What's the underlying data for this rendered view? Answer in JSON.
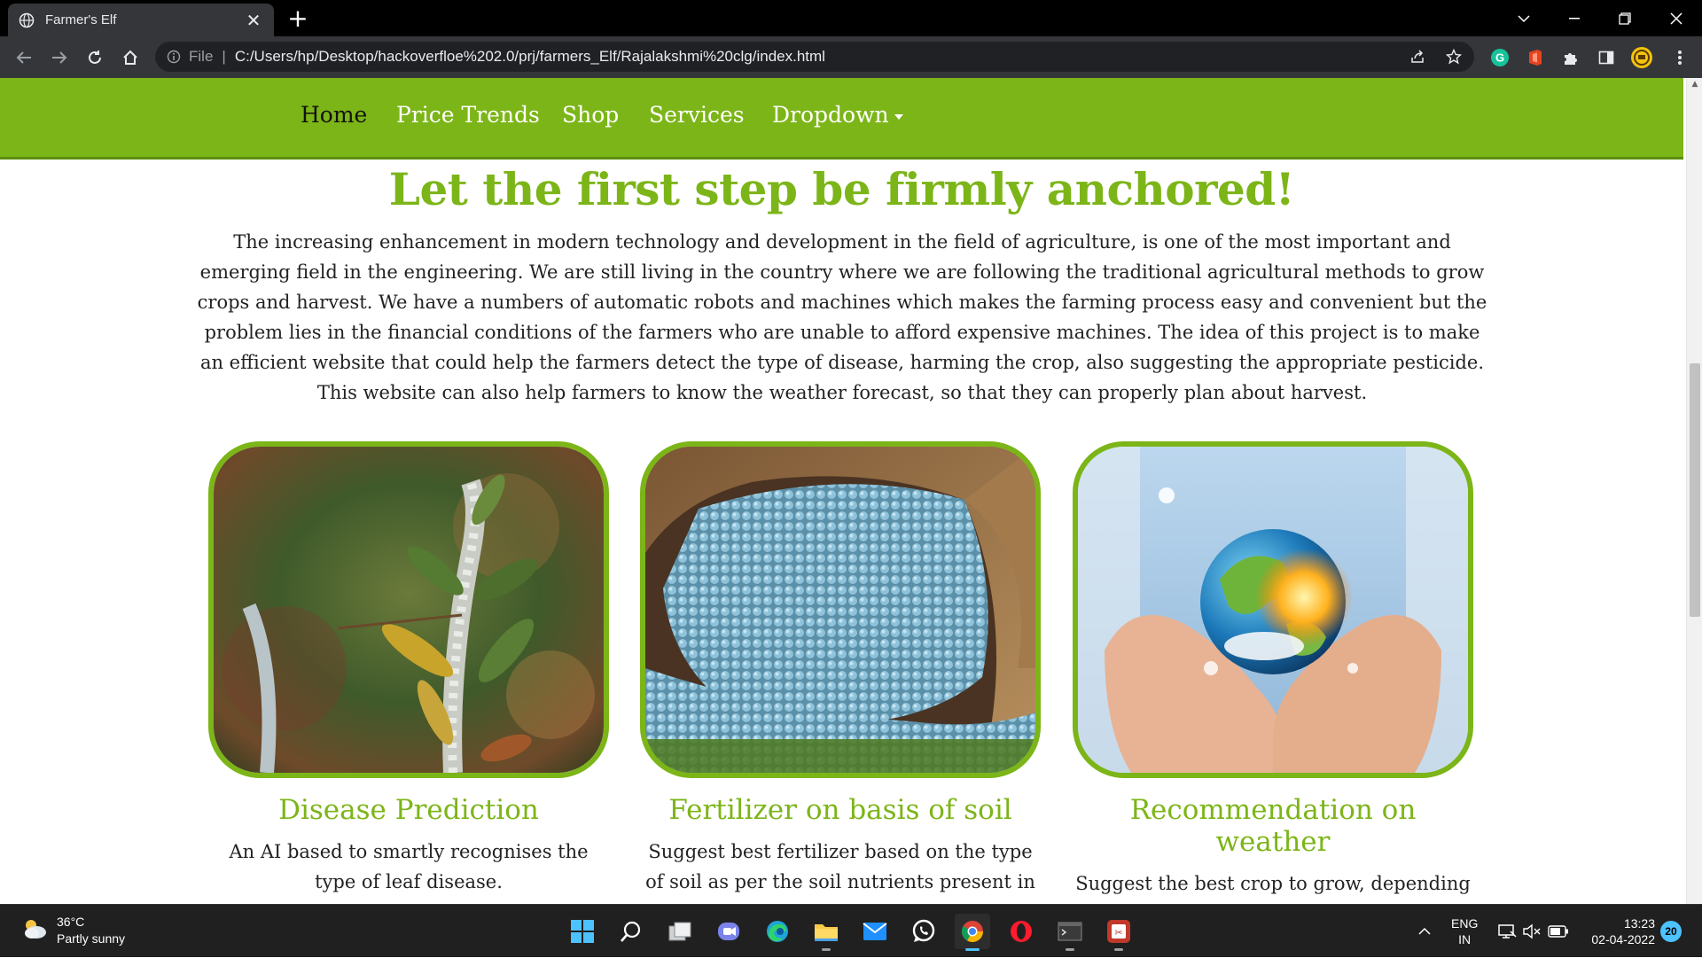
{
  "browser": {
    "tab_title": "Farmer's Elf",
    "url_scheme": "File",
    "url": "C:/Users/hp/Desktop/hackoverfloe%202.0/prj/farmers_Elf/Rajalakshmi%20clg/index.html"
  },
  "site": {
    "nav": [
      {
        "label": "Home",
        "active": true
      },
      {
        "label": "Price Trends"
      },
      {
        "label": "Shop"
      },
      {
        "label": "Services"
      },
      {
        "label": "Dropdown"
      }
    ],
    "hero_title": "Let the first step be firmly anchored!",
    "intro": "The increasing enhancement in modern technology and development in the field of agriculture, is one of the most important and emerging field in the engineering. We are still living in the country where we are following the traditional agricultural methods to grow crops and harvest. We have a numbers of automatic robots and machines which makes the farming process easy and convenient but the problem lies in the financial conditions of the farmers who are unable to afford expensive machines. The idea of this project is to make an efficient website that could help the farmers detect the type of disease, harming the crop, also suggesting the appropriate pesticide. This website can also help farmers to know the weather forecast, so that they can properly plan about harvest.",
    "cards": [
      {
        "title": "Disease Prediction",
        "text": "An AI based to smartly recognises the type of leaf disease."
      },
      {
        "title": "Fertilizer on basis of soil",
        "text": "Suggest best fertilizer based on the type of soil as per the soil nutrients present in it."
      },
      {
        "title": "Recommendation on weather",
        "text": "Suggest the best crop to grow, depending upon the weather of the particular location."
      }
    ],
    "accent_color": "#7cb518"
  },
  "taskbar": {
    "weather_temp": "36°C",
    "weather_desc": "Partly sunny",
    "lang_top": "ENG",
    "lang_bottom": "IN",
    "time": "13:23",
    "date": "02-04-2022",
    "notification_count": "20"
  }
}
